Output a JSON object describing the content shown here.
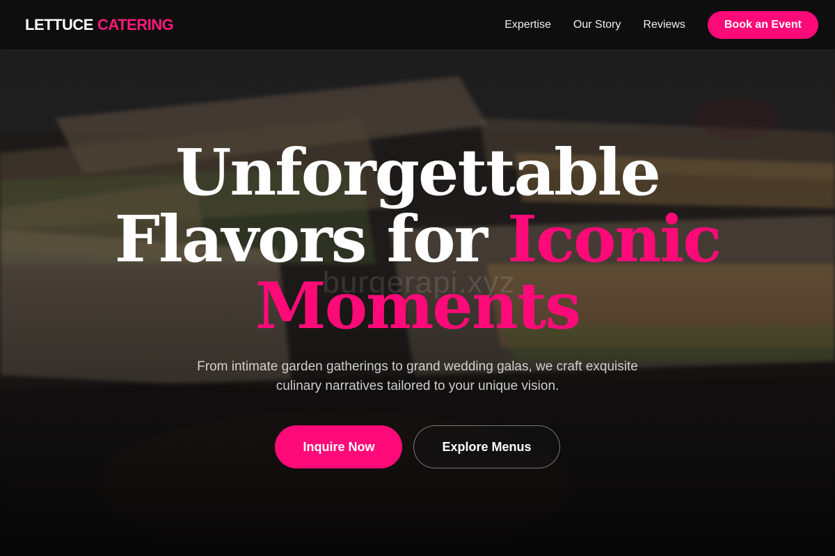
{
  "brand": {
    "main": "LETTUCE",
    "accent": "CATERING"
  },
  "nav": {
    "links": [
      "Expertise",
      "Our Story",
      "Reviews"
    ],
    "cta_label": "Book an Event"
  },
  "hero": {
    "headline_line1": "Unforgettable",
    "headline_line2_plain": "Flavors for",
    "headline_line2_accent": "Iconic",
    "headline_line3_accent": "Moments",
    "subtitle": "From intimate garden gatherings to grand wedding galas, we craft exquisite culinary narratives tailored to your unique vision.",
    "primary_cta": "Inquire Now",
    "secondary_cta": "Explore Menus",
    "watermark": "burgerapi.xyz"
  },
  "colors": {
    "accent": "#ff0a78",
    "nav_background": "#0c0c0e",
    "text": "#ffffff"
  }
}
